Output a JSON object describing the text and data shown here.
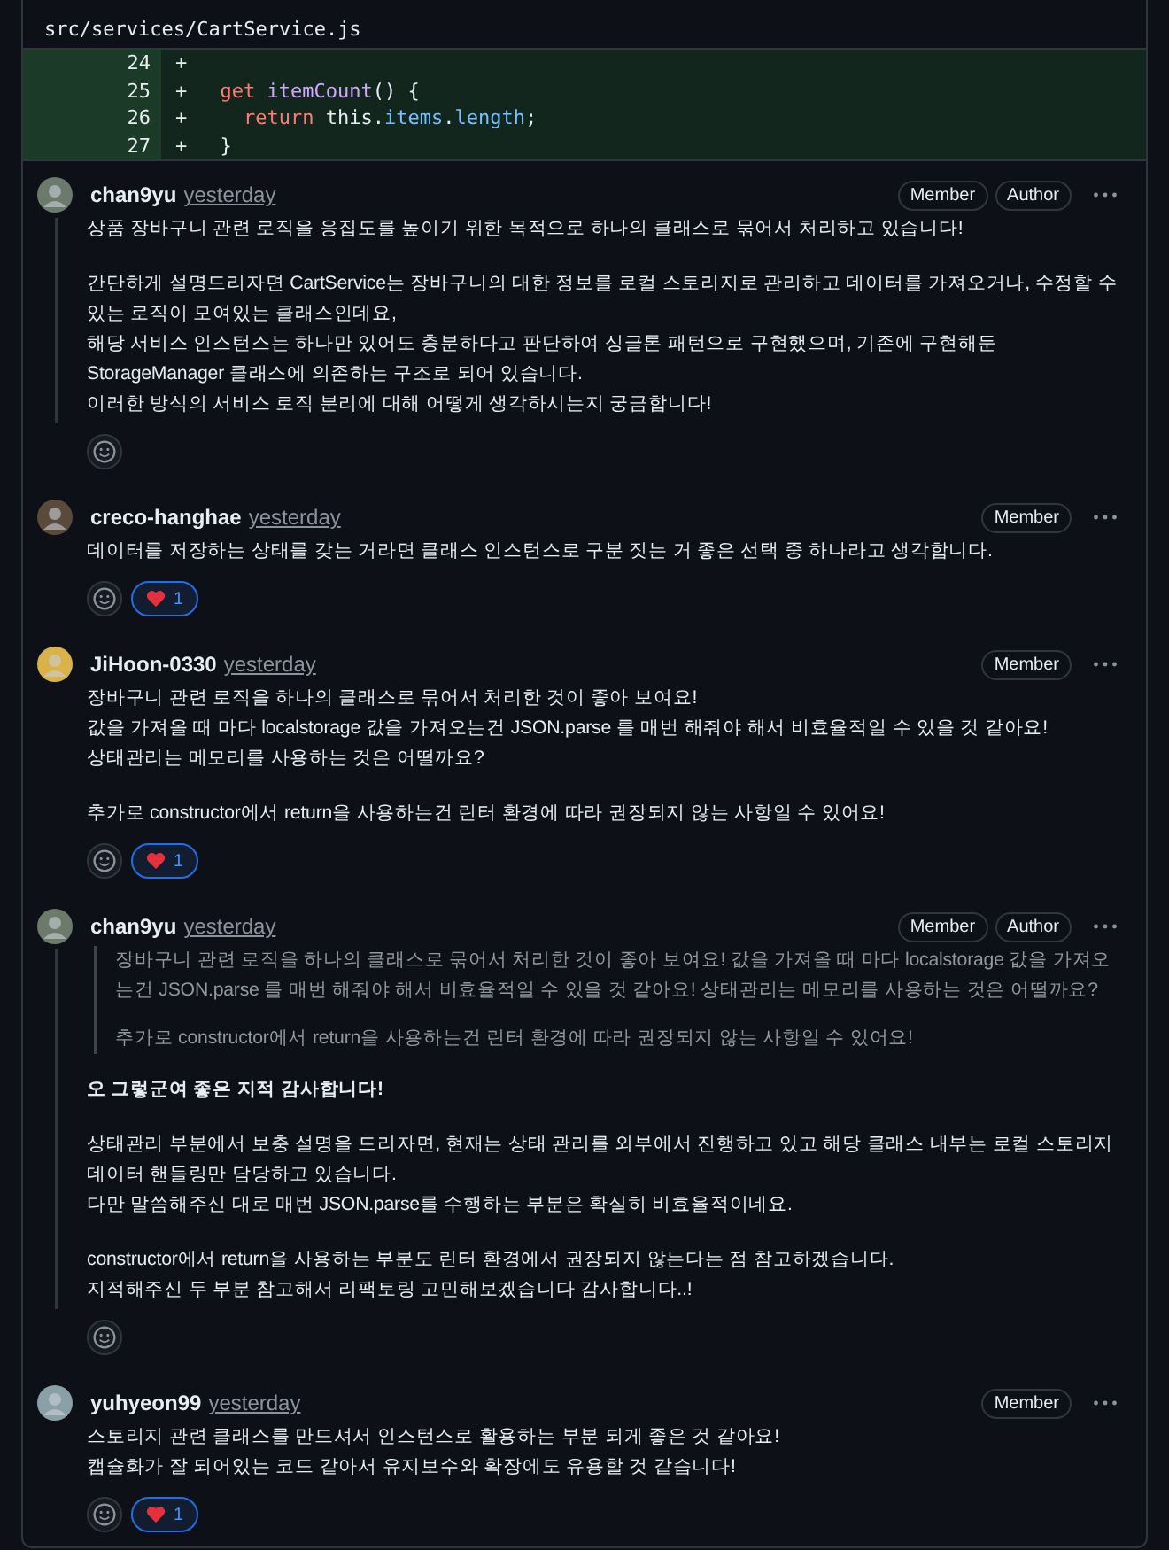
{
  "file": {
    "path": "src/services/CartService.js",
    "lines": [
      {
        "number": "24",
        "sign": "+"
      },
      {
        "number": "25",
        "sign": "+",
        "tokens": [
          {
            "kind": "keyword",
            "text": "  get"
          },
          {
            "kind": "function",
            "text": " itemCount"
          },
          {
            "kind": "plain",
            "text": "() {"
          }
        ]
      },
      {
        "number": "26",
        "sign": "+",
        "tokens": [
          {
            "kind": "keyword",
            "text": "    return"
          },
          {
            "kind": "plain",
            "text": " this."
          },
          {
            "kind": "property",
            "text": "items"
          },
          {
            "kind": "plain",
            "text": "."
          },
          {
            "kind": "property",
            "text": "length"
          },
          {
            "kind": "plain",
            "text": ";"
          }
        ]
      },
      {
        "number": "27",
        "sign": "+",
        "tokens": [
          {
            "kind": "plain",
            "text": "  }"
          }
        ]
      }
    ]
  },
  "comments": [
    {
      "author": "chan9yu",
      "time": "yesterday",
      "badges": [
        "Member",
        "Author"
      ],
      "paragraphs": [
        "상품 장바구니 관련 로직을 응집도를 높이기 위한 목적으로 하나의 클래스로 묶어서 처리하고 있습니다!",
        "간단하게 설명드리자면 CartService는 장바구니의 대한 정보를 로컬 스토리지로 관리하고 데이터를 가져오거나, 수정할 수 있는 로직이 모여있는 클래스인데요,\n해당 서비스 인스턴스는 하나만 있어도 충분하다고 판단하여 싱글톤 패턴으로 구현했으며, 기존에 구현해둔 StorageManager 클래스에 의존하는 구조로 되어 있습니다.\n이러한 방식의 서비스 로직 분리에 대해 어떻게 생각하시는지 궁금합니다!"
      ]
    },
    {
      "author": "creco-hanghae",
      "time": "yesterday",
      "badges": [
        "Member"
      ],
      "paragraphs": [
        "데이터를 저장하는 상태를 갖는 거라면 클래스 인스턴스로 구분 짓는 거 좋은 선택 중 하나라고 생각합니다."
      ],
      "reactions": [
        {
          "count": "1",
          "selected": true
        }
      ]
    },
    {
      "author": "JiHoon-0330",
      "time": "yesterday",
      "badges": [
        "Member"
      ],
      "paragraphs": [
        "장바구니 관련 로직을 하나의 클래스로 묶어서 처리한 것이 좋아 보여요!\n값을 가져올 때 마다 localstorage 값을 가져오는건 JSON.parse 를 매번 해줘야 해서 비효율적일 수 있을 것 같아요!\n상태관리는 메모리를 사용하는 것은 어떨까요?",
        "추가로 constructor에서 return을 사용하는건 린터 환경에 따라 권장되지 않는 사항일 수 있어요!"
      ],
      "reactions": [
        {
          "count": "1",
          "selected": true
        }
      ]
    },
    {
      "author": "chan9yu",
      "time": "yesterday",
      "badges": [
        "Member",
        "Author"
      ],
      "quote": [
        "장바구니 관련 로직을 하나의 클래스로 묶어서 처리한 것이 좋아 보여요! 값을 가져올 때 마다 localstorage 값을 가져오는건 JSON.parse 를 매번 해줘야 해서 비효율적일 수 있을 것 같아요! 상태관리는 메모리를 사용하는 것은 어떨까요?",
        "추가로 constructor에서 return을 사용하는건 린터 환경에 따라 권장되지 않는 사항일 수 있어요!"
      ],
      "paragraphs": [
        "오 그렇군여 좋은 지적 감사합니다!",
        "상태관리 부분에서 보충 설명을 드리자면, 현재는 상태 관리를 외부에서 진행하고 있고 해당 클래스 내부는 로컬 스토리지 데이터 핸들링만 담당하고 있습니다.\n다만 말씀해주신 대로 매번 JSON.parse를 수행하는 부분은 확실히 비효율적이네요.",
        "constructor에서 return을 사용하는 부분도 린터 환경에서 권장되지 않는다는 점 참고하겠습니다.\n지적해주신 두 부분 참고해서 리팩토링 고민해보겠습니다 감사합니다..!"
      ]
    },
    {
      "author": "yuhyeon99",
      "time": "yesterday",
      "badges": [
        "Member"
      ],
      "paragraphs": [
        "스토리지 관련 클래스를 만드셔서 인스턴스로 활용하는 부분 되게 좋은 것 같아요!\n캡슐화가 잘 되어있는 코드 같아서 유지보수와 확장에도 유용할 것 같습니다!"
      ],
      "reactions": [
        {
          "count": "1",
          "selected": true
        }
      ]
    }
  ]
}
